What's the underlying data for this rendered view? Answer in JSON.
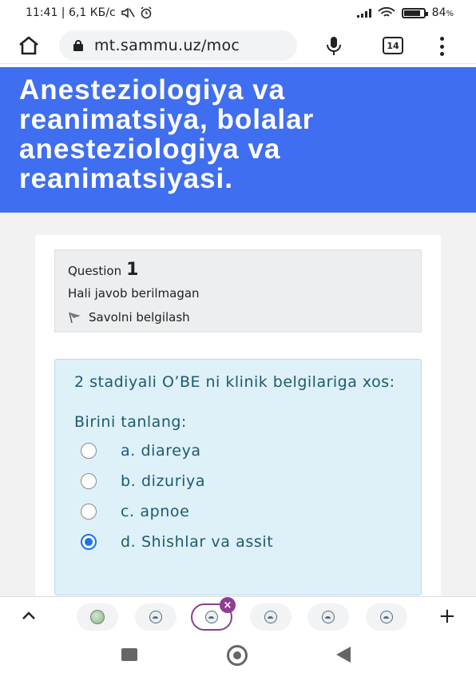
{
  "status_bar": {
    "time_info": "11:41 | 6,1 КБ/с",
    "battery_percent": "84",
    "battery_unit": "%",
    "battery_level": 0.84
  },
  "browser": {
    "url": "mt.sammu.uz/moc",
    "tab_count": "14"
  },
  "page": {
    "title": "Anesteziologiya va reanimatsiya, bolalar anesteziologiya va reanimatsiyasi."
  },
  "question": {
    "label": "Question",
    "number": "1",
    "state": "Hali javob berilmagan",
    "flag_label": "Savolni belgilash",
    "text": "2 stadiyali O’BE ni klinik belgilariga xos:",
    "prompt": "Birini tanlang:",
    "answers": [
      {
        "label": "a. diareya",
        "selected": false
      },
      {
        "label": "b. dizuriya",
        "selected": false
      },
      {
        "label": "c. apnoe",
        "selected": false
      },
      {
        "label": "d. Shishlar va assit",
        "selected": true
      }
    ]
  },
  "colors": {
    "header_bg": "#3f6ef0",
    "formulation_bg": "#def0f8",
    "formulation_text": "#1e5b6e",
    "radio_selected": "#1a73e8",
    "active_tab": "#8e3e91"
  },
  "icons": {
    "status": [
      "mute-icon",
      "alarm-icon",
      "signal-icon",
      "wifi-icon",
      "battery-icon"
    ],
    "browser": [
      "home-icon",
      "lock-icon",
      "mic-icon",
      "tab-switcher-icon",
      "more-menu-icon"
    ],
    "toolbar": [
      "chevron-up-icon",
      "plus-icon",
      "close-icon"
    ],
    "nav": [
      "recents-icon",
      "home-nav-icon",
      "back-icon"
    ]
  }
}
